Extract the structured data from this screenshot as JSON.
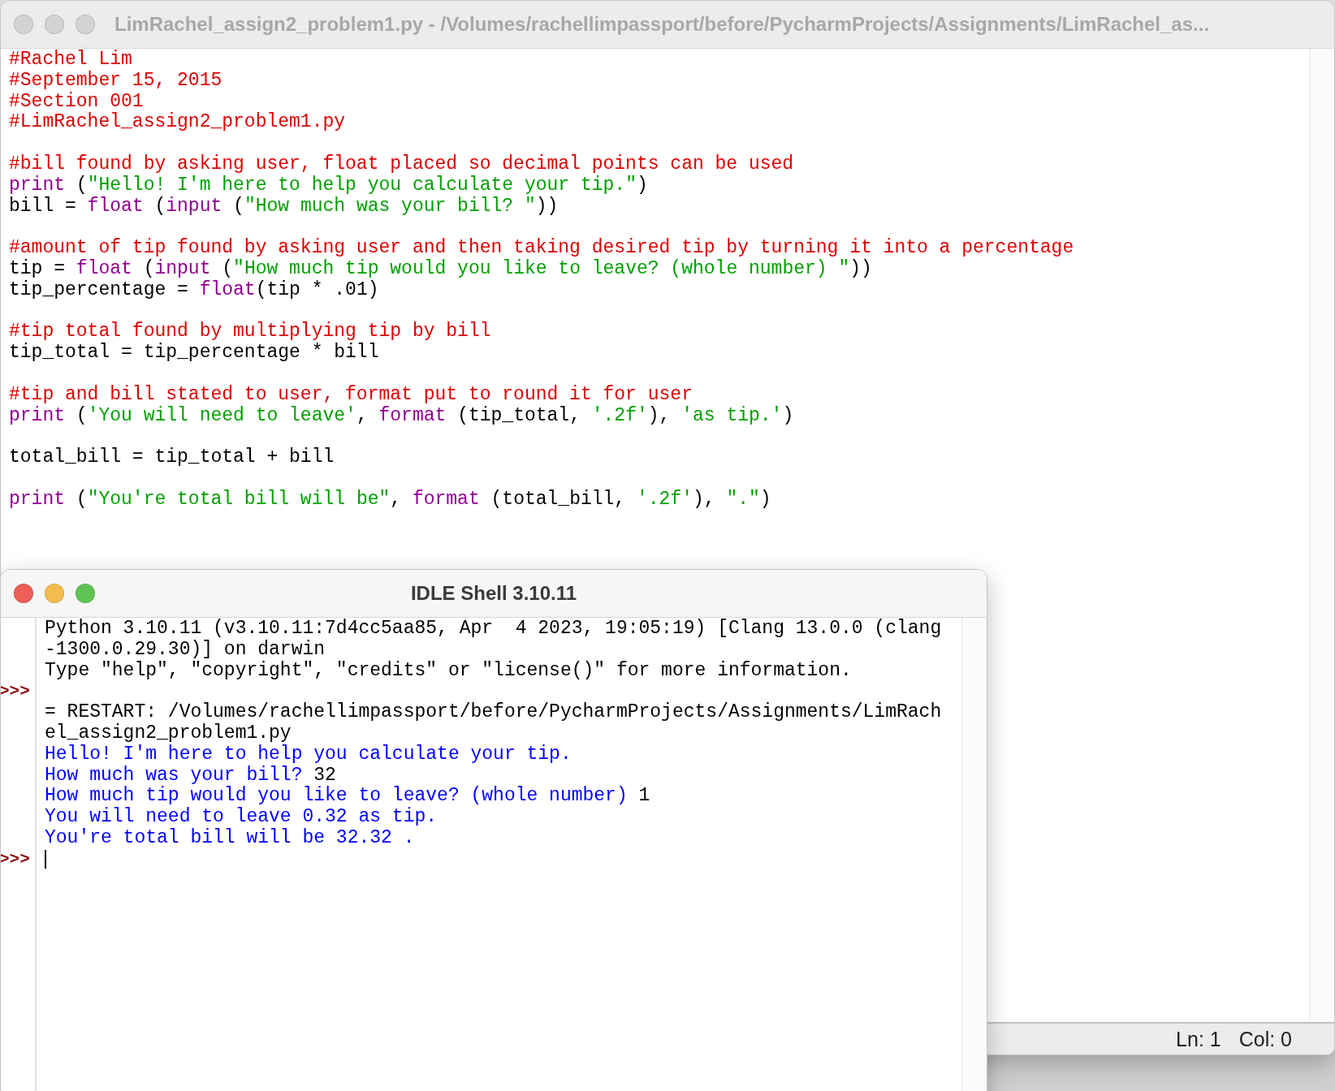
{
  "editor": {
    "title": "LimRachel_assign2_problem1.py - /Volumes/rachellimpassport/before/PycharmProjects/Assignments/LimRachel_as...",
    "active": false,
    "lines": [
      {
        "kind": "code",
        "segments": [
          {
            "kind": "comment",
            "text": "#Rachel Lim"
          }
        ]
      },
      {
        "kind": "code",
        "segments": [
          {
            "kind": "comment",
            "text": "#September 15, 2015"
          }
        ]
      },
      {
        "kind": "code",
        "segments": [
          {
            "kind": "comment",
            "text": "#Section 001"
          }
        ]
      },
      {
        "kind": "code",
        "segments": [
          {
            "kind": "comment",
            "text": "#LimRachel_assign2_problem1.py"
          }
        ]
      },
      {
        "kind": "blank"
      },
      {
        "kind": "code",
        "segments": [
          {
            "kind": "comment",
            "text": "#bill found by asking user, float placed so decimal points can be used"
          }
        ]
      },
      {
        "kind": "code",
        "segments": [
          {
            "kind": "builtin",
            "text": "print"
          },
          {
            "kind": "plain",
            "text": " ("
          },
          {
            "kind": "string",
            "text": "\"Hello! I'm here to help you calculate your tip.\""
          },
          {
            "kind": "plain",
            "text": ")"
          }
        ]
      },
      {
        "kind": "code",
        "segments": [
          {
            "kind": "plain",
            "text": "bill = "
          },
          {
            "kind": "builtin",
            "text": "float"
          },
          {
            "kind": "plain",
            "text": " ("
          },
          {
            "kind": "builtin",
            "text": "input"
          },
          {
            "kind": "plain",
            "text": " ("
          },
          {
            "kind": "string",
            "text": "\"How much was your bill? \""
          },
          {
            "kind": "plain",
            "text": "))"
          }
        ]
      },
      {
        "kind": "blank"
      },
      {
        "kind": "code",
        "segments": [
          {
            "kind": "comment",
            "text": "#amount of tip found by asking user and then taking desired tip by turning it into a percentage"
          }
        ]
      },
      {
        "kind": "code",
        "segments": [
          {
            "kind": "plain",
            "text": "tip = "
          },
          {
            "kind": "builtin",
            "text": "float"
          },
          {
            "kind": "plain",
            "text": " ("
          },
          {
            "kind": "builtin",
            "text": "input"
          },
          {
            "kind": "plain",
            "text": " ("
          },
          {
            "kind": "string",
            "text": "\"How much tip would you like to leave? (whole number) \""
          },
          {
            "kind": "plain",
            "text": "))"
          }
        ]
      },
      {
        "kind": "code",
        "segments": [
          {
            "kind": "plain",
            "text": "tip_percentage = "
          },
          {
            "kind": "builtin",
            "text": "float"
          },
          {
            "kind": "plain",
            "text": "(tip * .01)"
          }
        ]
      },
      {
        "kind": "blank"
      },
      {
        "kind": "code",
        "segments": [
          {
            "kind": "comment",
            "text": "#tip total found by multiplying tip by bill"
          }
        ]
      },
      {
        "kind": "code",
        "segments": [
          {
            "kind": "plain",
            "text": "tip_total = tip_percentage * bill"
          }
        ]
      },
      {
        "kind": "blank"
      },
      {
        "kind": "code",
        "segments": [
          {
            "kind": "comment",
            "text": "#tip and bill stated to user, format put to round it for user"
          }
        ]
      },
      {
        "kind": "code",
        "segments": [
          {
            "kind": "builtin",
            "text": "print"
          },
          {
            "kind": "plain",
            "text": " ("
          },
          {
            "kind": "string",
            "text": "'You will need to leave'"
          },
          {
            "kind": "plain",
            "text": ", "
          },
          {
            "kind": "builtin",
            "text": "format"
          },
          {
            "kind": "plain",
            "text": " (tip_total, "
          },
          {
            "kind": "string",
            "text": "'.2f'"
          },
          {
            "kind": "plain",
            "text": "), "
          },
          {
            "kind": "string",
            "text": "'as tip.'"
          },
          {
            "kind": "plain",
            "text": ")"
          }
        ]
      },
      {
        "kind": "blank"
      },
      {
        "kind": "code",
        "segments": [
          {
            "kind": "plain",
            "text": "total_bill = tip_total + bill"
          }
        ]
      },
      {
        "kind": "blank"
      },
      {
        "kind": "code",
        "segments": [
          {
            "kind": "builtin",
            "text": "print"
          },
          {
            "kind": "plain",
            "text": " ("
          },
          {
            "kind": "string",
            "text": "\"You're total bill will be\""
          },
          {
            "kind": "plain",
            "text": ", "
          },
          {
            "kind": "builtin",
            "text": "format"
          },
          {
            "kind": "plain",
            "text": " (total_bill, "
          },
          {
            "kind": "string",
            "text": "'.2f'"
          },
          {
            "kind": "plain",
            "text": "), "
          },
          {
            "kind": "string",
            "text": "\".\""
          },
          {
            "kind": "plain",
            "text": ")"
          }
        ]
      }
    ],
    "status_bar": {
      "line": "Ln: 1",
      "column": "Col: 0"
    }
  },
  "shell": {
    "title": "IDLE Shell 3.10.11",
    "active": true,
    "lines": [
      {
        "segments": [
          {
            "kind": "console",
            "text": "Python 3.10.11 (v3.10.11:7d4cc5aa85, Apr  4 2023, 19:05:19) [Clang 13.0.0 (clang"
          }
        ]
      },
      {
        "segments": [
          {
            "kind": "console",
            "text": "-1300.0.29.30)] on darwin"
          }
        ]
      },
      {
        "segments": [
          {
            "kind": "console",
            "text": "Type \"help\", \"copyright\", \"credits\" or \"license()\" for more information."
          }
        ]
      },
      {
        "prompt": ">>>"
      },
      {
        "segments": [
          {
            "kind": "console",
            "text": "= RESTART: /Volumes/rachellimpassport/before/PycharmProjects/Assignments/LimRach"
          }
        ]
      },
      {
        "segments": [
          {
            "kind": "console",
            "text": "el_assign2_problem1.py"
          }
        ]
      },
      {
        "segments": [
          {
            "kind": "stdout",
            "text": "Hello! I'm here to help you calculate your tip."
          }
        ]
      },
      {
        "segments": [
          {
            "kind": "stdout",
            "text": "How much was your bill? "
          },
          {
            "kind": "stdin",
            "text": "32"
          }
        ]
      },
      {
        "segments": [
          {
            "kind": "stdout",
            "text": "How much tip would you like to leave? (whole number) "
          },
          {
            "kind": "stdin",
            "text": "1"
          }
        ]
      },
      {
        "segments": [
          {
            "kind": "stdout",
            "text": "You will need to leave 0.32 as tip."
          }
        ]
      },
      {
        "segments": [
          {
            "kind": "stdout",
            "text": "You're total bill will be 32.32 ."
          }
        ]
      },
      {
        "prompt": ">>>",
        "cursor": true
      }
    ]
  }
}
